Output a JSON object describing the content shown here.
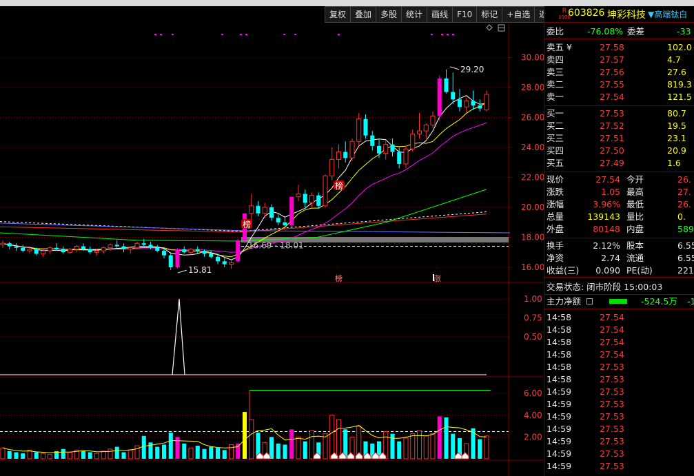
{
  "toolbar": [
    "复权",
    "叠加",
    "多股",
    "统计",
    "画线",
    "F10",
    "标记",
    "+自选",
    "返回"
  ],
  "stock": {
    "code": "603826",
    "name": "坤彩科技",
    "tag": "▼高端钛白",
    "badge_top": "R",
    "badge_bottom": "1000"
  },
  "weibi": {
    "label1": "委比",
    "value1": "-76.08%",
    "label2": "委差",
    "value2": "-33"
  },
  "sells": [
    {
      "label": "卖五 ¥",
      "price": "27.58",
      "vol": "102.0"
    },
    {
      "label": "卖四",
      "price": "27.57",
      "vol": "4.7"
    },
    {
      "label": "卖三",
      "price": "27.56",
      "vol": "27.6"
    },
    {
      "label": "卖二",
      "price": "27.55",
      "vol": "819.3"
    },
    {
      "label": "卖一",
      "price": "27.54",
      "vol": "121.5"
    }
  ],
  "buys": [
    {
      "label": "买一",
      "price": "27.53",
      "vol": "80.7"
    },
    {
      "label": "买二",
      "price": "27.52",
      "vol": "19.5"
    },
    {
      "label": "买三",
      "price": "27.51",
      "vol": "23.1"
    },
    {
      "label": "买四",
      "price": "27.50",
      "vol": "20.9"
    },
    {
      "label": "买五",
      "price": "27.49",
      "vol": "1.6"
    }
  ],
  "quote": [
    {
      "l1": "现价",
      "v1": "27.54",
      "c1": "red",
      "l2": "今开",
      "v2": "26.",
      "c2": "red"
    },
    {
      "l1": "涨跌",
      "v1": "1.05",
      "c1": "red",
      "l2": "最高",
      "v2": "27.",
      "c2": "red"
    },
    {
      "l1": "涨幅",
      "v1": "3.96%",
      "c1": "red",
      "l2": "最低",
      "v2": "26.",
      "c2": "red"
    },
    {
      "l1": "总量",
      "v1": "139143",
      "c1": "yel",
      "l2": "量比",
      "v2": "0.",
      "c2": "yel"
    },
    {
      "l1": "外盘",
      "v1": "80148",
      "c1": "red",
      "l2": "内盘",
      "v2": "589",
      "c2": "grn"
    }
  ],
  "fund": [
    {
      "l1": "换手",
      "v1": "2.12%",
      "l2": "股本",
      "v2": "6.55"
    },
    {
      "l1": "净资",
      "v1": "2.74",
      "l2": "流通",
      "v2": "6.55"
    },
    {
      "l1": "收益(三)",
      "v1": "0.090",
      "l2": "PE(动)",
      "v2": "221"
    }
  ],
  "status": "交易状态: 闭市阶段 15:00:03",
  "mainflow": {
    "label": "主力净额",
    "value": "-524.5万",
    "extra": "-1"
  },
  "ticks": [
    {
      "t": "14:58",
      "p": "27.54"
    },
    {
      "t": "14:58",
      "p": "27.54"
    },
    {
      "t": "14:58",
      "p": "27.54"
    },
    {
      "t": "14:58",
      "p": "27.54"
    },
    {
      "t": "14:58",
      "p": "27.53"
    },
    {
      "t": "14:58",
      "p": "27.53"
    },
    {
      "t": "14:59",
      "p": "27.53"
    },
    {
      "t": "14:59",
      "p": "27.53"
    },
    {
      "t": "14:59",
      "p": "27.53"
    },
    {
      "t": "14:59",
      "p": "27.53"
    },
    {
      "t": "14:59",
      "p": "27.53"
    },
    {
      "t": "14:59",
      "p": "27.53"
    },
    {
      "t": "14:59",
      "p": "27.53"
    }
  ],
  "chart": {
    "price_axis": [
      "30.00",
      "28.00",
      "26.00",
      "24.00",
      "22.00",
      "20.00",
      "18.00",
      "16.00"
    ],
    "ind_axis": [
      "1.00",
      "0.75",
      "0.50"
    ],
    "vol_axis": [
      "6.00",
      "4.00",
      "2.00"
    ],
    "annotations": {
      "high": "29.20",
      "low": "15.81",
      "mid": "16.69 - 18.01",
      "bang1": "榜",
      "bang2": "榜",
      "bottom1": "榜",
      "bottom2": "涨"
    },
    "colors": {
      "up": "#ff3030",
      "down": "#00ffff",
      "limit": "#ff00cc",
      "ma5": "#ffffff",
      "ma10": "#ffff00",
      "ma20": "#ff00ff",
      "ma60": "#00ff00",
      "ma120": "#ff3030"
    },
    "candles": [
      [
        17.5,
        17.8,
        17.3,
        17.6
      ],
      [
        17.6,
        17.7,
        17.2,
        17.4
      ],
      [
        17.4,
        17.6,
        17.1,
        17.3
      ],
      [
        17.3,
        17.5,
        17.0,
        17.1
      ],
      [
        17.1,
        17.4,
        16.9,
        17.2
      ],
      [
        17.2,
        17.3,
        16.8,
        16.9
      ],
      [
        16.9,
        17.2,
        16.7,
        17.1
      ],
      [
        17.1,
        17.4,
        16.9,
        17.3
      ],
      [
        17.3,
        17.6,
        17.1,
        17.2
      ],
      [
        17.2,
        17.4,
        16.9,
        17.0
      ],
      [
        17.0,
        17.3,
        16.9,
        17.2
      ],
      [
        17.2,
        17.5,
        17.0,
        17.4
      ],
      [
        17.4,
        17.6,
        17.1,
        17.2
      ],
      [
        17.2,
        17.4,
        16.9,
        17.0
      ],
      [
        17.0,
        17.2,
        16.8,
        17.1
      ],
      [
        17.1,
        17.4,
        16.9,
        17.3
      ],
      [
        17.3,
        17.6,
        17.1,
        17.5
      ],
      [
        17.5,
        17.8,
        17.3,
        17.4
      ],
      [
        17.4,
        17.6,
        17.0,
        17.2
      ],
      [
        17.2,
        17.4,
        16.9,
        17.3
      ],
      [
        17.3,
        17.7,
        17.2,
        17.6
      ],
      [
        17.6,
        17.9,
        17.4,
        17.5
      ],
      [
        17.5,
        17.7,
        17.2,
        17.3
      ],
      [
        17.3,
        17.5,
        17.0,
        17.1
      ],
      [
        17.1,
        17.2,
        16.6,
        16.8
      ],
      [
        16.8,
        17.0,
        15.81,
        16.0
      ],
      [
        16.0,
        17.3,
        15.9,
        17.2
      ],
      [
        17.2,
        17.4,
        16.9,
        17.0
      ],
      [
        17.0,
        17.3,
        16.8,
        17.2
      ],
      [
        17.2,
        17.4,
        16.9,
        17.1
      ],
      [
        17.1,
        17.2,
        16.7,
        16.9
      ],
      [
        16.9,
        17.1,
        16.6,
        16.7
      ],
      [
        16.7,
        16.9,
        16.2,
        16.4
      ],
      [
        16.4,
        16.7,
        16.0,
        16.2
      ],
      [
        16.2,
        16.5,
        15.9,
        16.3
      ],
      [
        16.4,
        17.9,
        16.3,
        17.8
      ],
      [
        17.8,
        19.6,
        17.6,
        19.6
      ],
      [
        19.6,
        20.9,
        19.2,
        20.1
      ],
      [
        20.1,
        20.4,
        19.4,
        19.6
      ],
      [
        19.6,
        20.3,
        19.3,
        20.0
      ],
      [
        20.0,
        20.2,
        19.1,
        19.3
      ],
      [
        19.3,
        19.6,
        18.8,
        19.0
      ],
      [
        19.0,
        19.4,
        18.6,
        18.8
      ],
      [
        18.8,
        20.7,
        18.7,
        20.7
      ],
      [
        20.7,
        21.5,
        20.4,
        20.9
      ],
      [
        20.9,
        21.2,
        20.0,
        20.3
      ],
      [
        20.3,
        21.0,
        20.0,
        20.8
      ],
      [
        20.8,
        21.0,
        19.9,
        20.1
      ],
      [
        20.1,
        22.2,
        20.0,
        22.1
      ],
      [
        22.1,
        24.0,
        21.8,
        23.2
      ],
      [
        23.2,
        24.2,
        22.6,
        23.7
      ],
      [
        23.7,
        24.4,
        23.0,
        23.3
      ],
      [
        23.3,
        24.6,
        23.1,
        24.4
      ],
      [
        24.4,
        26.3,
        24.1,
        25.9
      ],
      [
        25.9,
        26.2,
        24.6,
        24.8
      ],
      [
        24.8,
        25.1,
        23.8,
        24.1
      ],
      [
        24.1,
        24.6,
        23.3,
        23.6
      ],
      [
        23.6,
        24.5,
        23.2,
        24.2
      ],
      [
        24.2,
        24.6,
        23.4,
        23.7
      ],
      [
        23.7,
        24.0,
        22.6,
        22.9
      ],
      [
        22.9,
        24.1,
        22.6,
        23.9
      ],
      [
        23.9,
        25.2,
        23.7,
        24.9
      ],
      [
        24.9,
        26.3,
        24.6,
        25.1
      ],
      [
        25.1,
        25.6,
        24.6,
        25.5
      ],
      [
        25.5,
        26.4,
        25.3,
        26.1
      ],
      [
        26.1,
        28.8,
        25.8,
        28.6
      ],
      [
        28.6,
        29.2,
        27.6,
        27.7
      ],
      [
        27.7,
        29.0,
        26.9,
        27.2
      ],
      [
        27.2,
        27.9,
        26.4,
        26.7
      ],
      [
        26.7,
        27.3,
        26.3,
        27.1
      ],
      [
        27.1,
        27.8,
        26.5,
        26.8
      ],
      [
        26.8,
        27.2,
        26.4,
        26.6
      ],
      [
        26.5,
        27.8,
        26.4,
        27.54
      ]
    ],
    "limit_days": [
      26,
      35,
      36,
      43,
      65
    ],
    "volumes": [
      1.0,
      0.7,
      0.6,
      0.5,
      0.8,
      0.6,
      0.5,
      0.4,
      0.7,
      0.9,
      0.6,
      0.8,
      0.7,
      0.6,
      0.5,
      0.7,
      0.9,
      1.1,
      0.6,
      0.8,
      1.2,
      2.1,
      1.5,
      1.1,
      1.3,
      2.4,
      2.0,
      1.4,
      1.0,
      1.2,
      0.9,
      1.1,
      1.0,
      0.8,
      1.3,
      1.4,
      4.3,
      3.6,
      2.4,
      1.5,
      2.0,
      1.4,
      1.3,
      2.7,
      2.0,
      1.6,
      2.6,
      1.5,
      2.3,
      4.0,
      3.6,
      2.7,
      2.0,
      3.0,
      1.6,
      1.4,
      1.6,
      2.5,
      2.3,
      1.6,
      1.9,
      2.3,
      2.6,
      2.1,
      2.3,
      3.9,
      3.8,
      2.3,
      1.9,
      1.4,
      2.8,
      1.8,
      2.1
    ]
  }
}
